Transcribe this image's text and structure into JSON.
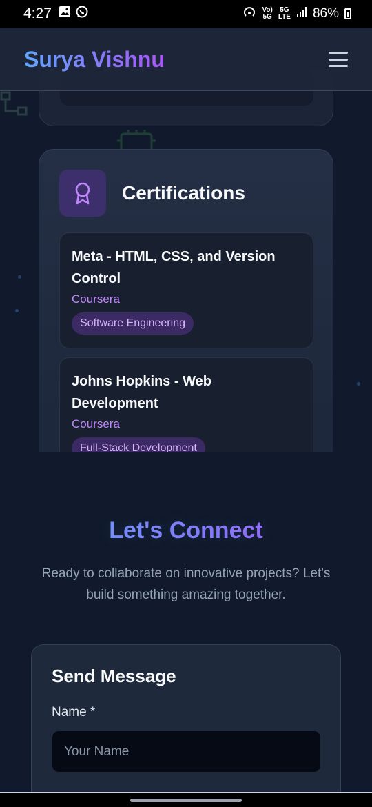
{
  "status_bar": {
    "time": "4:27",
    "battery": "86%",
    "network_top": "5G",
    "network_bottom": "LTE"
  },
  "header": {
    "brand": "Surya Vishnu",
    "gradient_start": "#60a5fa",
    "gradient_end": "#a855f7",
    "menu_icon": "hamburger-icon"
  },
  "certifications": {
    "icon": "award-icon",
    "title": "Certifications",
    "items": [
      {
        "name": "Meta - HTML, CSS, and Version Control",
        "issuer": "Coursera",
        "tag": "Software Engineering"
      },
      {
        "name": "Johns Hopkins - Web Development",
        "issuer": "Coursera",
        "tag": "Full-Stack Development"
      }
    ]
  },
  "connect": {
    "title": "Let's Connect",
    "subtitle": "Ready to collaborate on innovative projects? Let's build something amazing together.",
    "form": {
      "title": "Send Message",
      "name_label": "Name *",
      "name_placeholder": "Your Name",
      "name_value": ""
    }
  }
}
